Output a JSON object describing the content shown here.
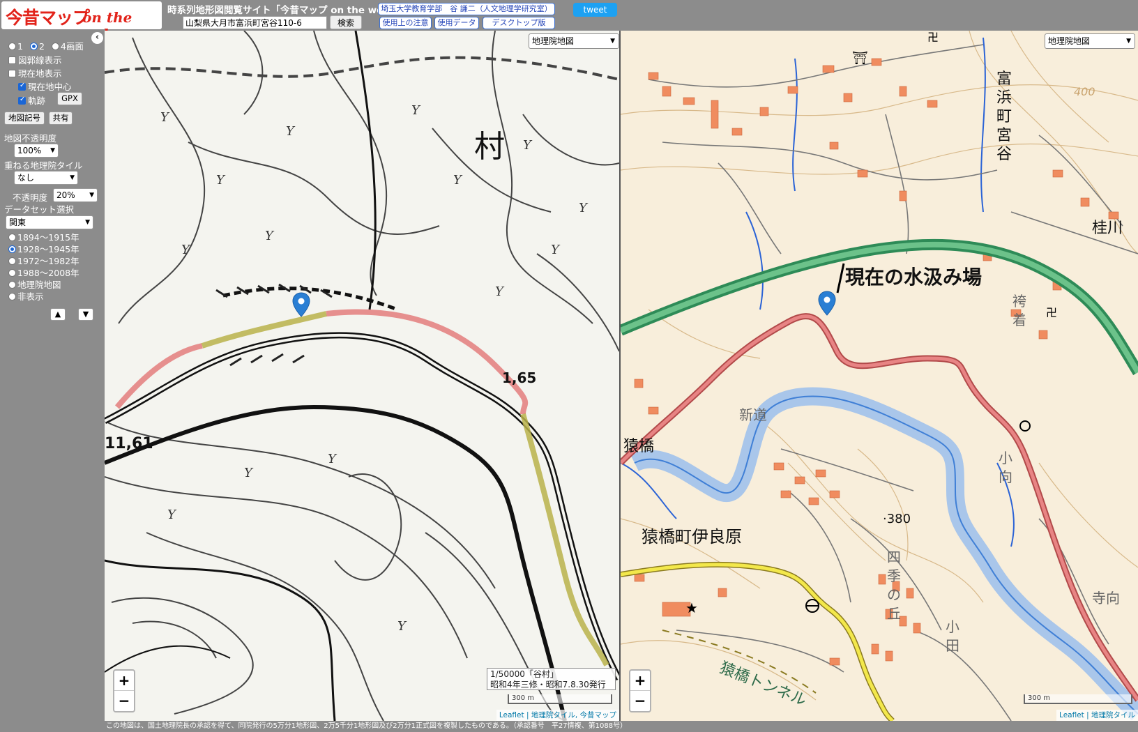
{
  "header": {
    "logo_main": "今昔マップ",
    "logo_sub": "on the web",
    "site_title": "時系列地形図閲覧サイト「今昔マップ on the web」",
    "address_value": "山梨県大月市富浜町宮谷110-6",
    "search_label": "検索",
    "author": "埼玉大学教育学部　谷 謙二（人文地理学研究室）",
    "notes_label": "使用上の注意",
    "data_label": "使用データ",
    "desktop_label": "デスクトップ版",
    "tweet_label": "tweet"
  },
  "sidebar": {
    "collapse_icon": "‹",
    "screens": [
      {
        "label": "1",
        "selected": false
      },
      {
        "label": "2",
        "selected": true
      },
      {
        "label": "4画面",
        "selected": false
      }
    ],
    "show_grid": "図郭線表示",
    "show_location": "現在地表示",
    "center_location": "現在地中心",
    "track": "軌跡",
    "gpx_label": "GPX",
    "legend_label": "地図記号",
    "share_label": "共有",
    "opacity_label": "地図不透明度",
    "opacity_value": "100%",
    "overlay_label": "重ねる地理院タイル",
    "overlay_value": "なし",
    "overlay_opacity_label": "不透明度",
    "overlay_opacity_value": "20%",
    "dataset_label": "データセット選択",
    "dataset_value": "関東",
    "periods": [
      {
        "label": "1894〜1915年",
        "selected": false
      },
      {
        "label": "1928〜1945年",
        "selected": true
      },
      {
        "label": "1972〜1982年",
        "selected": false
      },
      {
        "label": "1988〜2008年",
        "selected": false
      },
      {
        "label": "地理院地図",
        "selected": false
      },
      {
        "label": "非表示",
        "selected": false
      }
    ],
    "up_label": "▲",
    "down_label": "▼"
  },
  "left_map": {
    "layer_select": "地理院地図",
    "caption_line1": "1/50000「谷村」",
    "caption_line2": "昭和4年三修・昭和7.8.30発行",
    "scale_label": "300 m",
    "zoom_in": "+",
    "zoom_out": "−",
    "attribution": "Leaflet | 地理院タイル, 今昔マップ",
    "labels": {
      "village": "村",
      "elev1": "11,61",
      "elev2": "1,65"
    }
  },
  "right_map": {
    "layer_select": "地理院地図",
    "scale_label": "300 m",
    "zoom_in": "+",
    "zoom_out": "−",
    "attribution": "Leaflet | 地理院タイル",
    "annotation": "現在の水汲み場",
    "labels": {
      "tomihama": "富浜町宮谷",
      "katsuragawa": "桂川",
      "hakama": "袴着",
      "shindo": "新道",
      "saruhashi": "猿橋",
      "kogo": "小向",
      "irahara": "猿橋町伊良原",
      "elev": "·380",
      "shiki": "四季の丘",
      "koda": "小田",
      "terami": "寺向",
      "tunnel": "猿橋トンネル",
      "elev400": "400"
    }
  },
  "footer": {
    "note": "この地図は、国土地理院長の承認を得て、同院発行の5万分1地形図、2万5千分1地形図及び2万分1正式図を複製したものである。（承認番号　平27情複、第1088号）"
  }
}
